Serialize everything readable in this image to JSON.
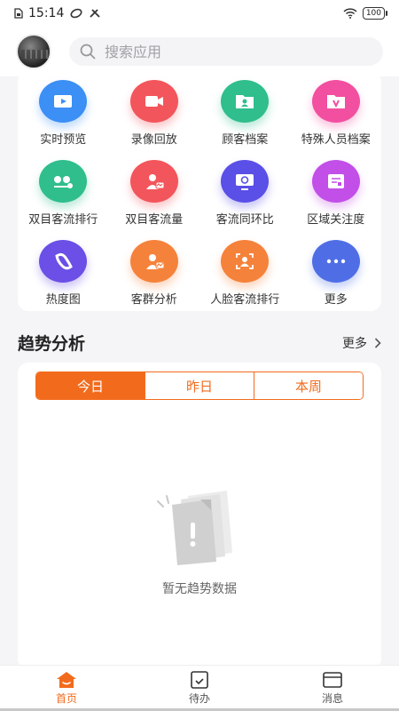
{
  "status_bar": {
    "time": "15:14",
    "battery": "100"
  },
  "search": {
    "placeholder": "搜索应用"
  },
  "grid": {
    "items": [
      {
        "label": "实时预览",
        "icon": "video-play-icon",
        "color": "#3b8ff5"
      },
      {
        "label": "录像回放",
        "icon": "video-camera-icon",
        "color": "#f2555b"
      },
      {
        "label": "顾客档案",
        "icon": "customer-folder-icon",
        "color": "#2fbe8c"
      },
      {
        "label": "特殊人员档案",
        "icon": "vip-folder-icon",
        "color": "#f24fa0"
      },
      {
        "label": "双目客流排行",
        "icon": "binocular-ranking-icon",
        "color": "#2fbe8c"
      },
      {
        "label": "双目客流量",
        "icon": "binocular-flow-icon",
        "color": "#f2555b"
      },
      {
        "label": "客流同环比",
        "icon": "comparison-monitor-icon",
        "color": "#5a4fe6"
      },
      {
        "label": "区域关注度",
        "icon": "region-attention-icon",
        "color": "#c24fe8"
      },
      {
        "label": "热度图",
        "icon": "heatmap-icon",
        "color": "#6b4fe6"
      },
      {
        "label": "客群分析",
        "icon": "customer-group-icon",
        "color": "#f5823b"
      },
      {
        "label": "人脸客流排行",
        "icon": "face-ranking-icon",
        "color": "#f5823b"
      },
      {
        "label": "更多",
        "icon": "more-dots-icon",
        "color": "#4f6ee6"
      }
    ]
  },
  "trend": {
    "title": "趋势分析",
    "more": "更多",
    "tabs": [
      "今日",
      "昨日",
      "本周"
    ],
    "active_tab": 0,
    "empty_text": "暂无趋势数据"
  },
  "nav": {
    "items": [
      {
        "label": "首页",
        "icon": "home-icon"
      },
      {
        "label": "待办",
        "icon": "todo-icon"
      },
      {
        "label": "消息",
        "icon": "message-icon"
      }
    ],
    "active": 0,
    "accent": "#f26b1d"
  }
}
